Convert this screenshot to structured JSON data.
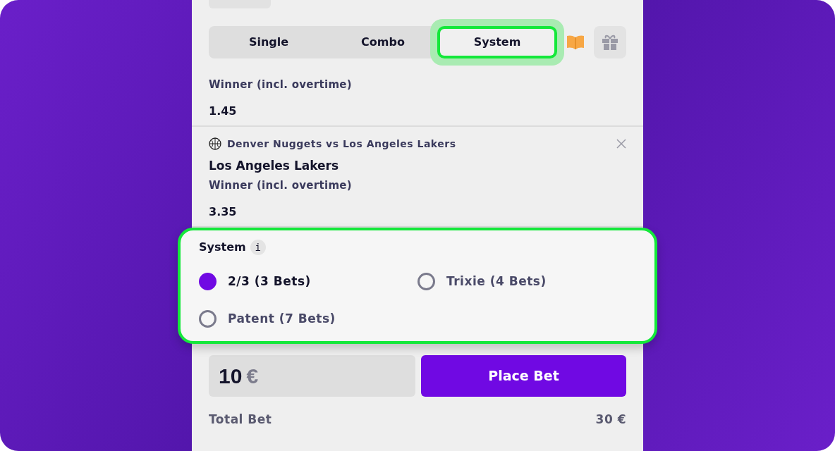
{
  "tabs": [
    {
      "label": "Single",
      "selected": false
    },
    {
      "label": "Combo",
      "selected": false
    },
    {
      "label": "System",
      "selected": true
    }
  ],
  "bets": [
    {
      "market": "Winner (incl. overtime)",
      "odds": "1.45"
    },
    {
      "event": "Denver Nuggets vs Los Angeles Lakers",
      "selection": "Los Angeles Lakers",
      "market": "Winner (incl. overtime)",
      "odds": "3.35"
    }
  ],
  "system": {
    "title": "System",
    "info": "i",
    "options": [
      {
        "label": "2/3 (3 Bets)",
        "selected": true
      },
      {
        "label": "Trixie (4 Bets)",
        "selected": false
      },
      {
        "label": "Patent (7 Bets)",
        "selected": false
      }
    ]
  },
  "stake": {
    "amount": "10",
    "currency": "€"
  },
  "place_bet": "Place Bet",
  "total": {
    "label": "Total Bet",
    "value": "30 €"
  }
}
